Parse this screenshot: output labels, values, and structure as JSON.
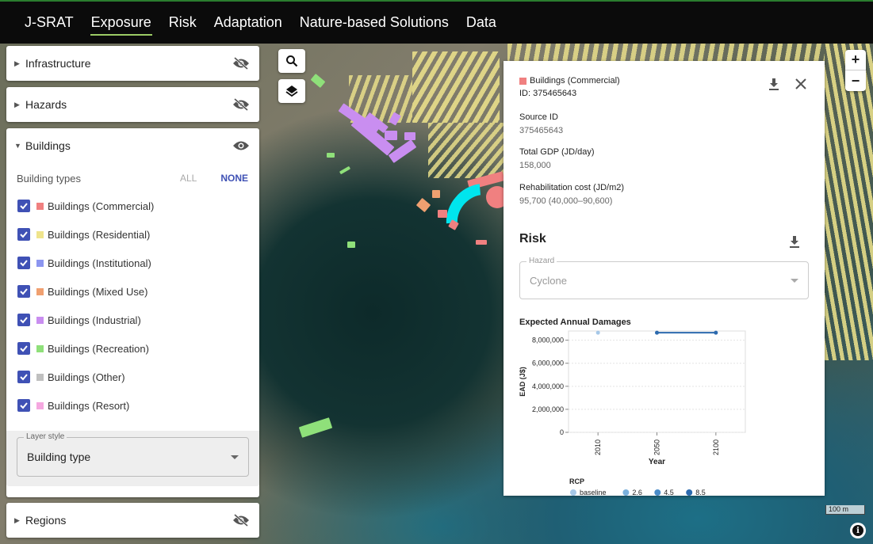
{
  "nav": {
    "brand": "J-SRAT",
    "items": [
      "Exposure",
      "Risk",
      "Adaptation",
      "Nature-based Solutions",
      "Data"
    ]
  },
  "sidebar": {
    "infrastructure": "Infrastructure",
    "hazards": "Hazards",
    "buildings": "Buildings",
    "regions": "Regions",
    "building_types_label": "Building types",
    "all_label": "ALL",
    "none_label": "NONE",
    "building_types": [
      {
        "label": "Buildings (Commercial)",
        "color": "#f08080",
        "checked": true
      },
      {
        "label": "Buildings (Residential)",
        "color": "#efe48c",
        "checked": true
      },
      {
        "label": "Buildings (Institutional)",
        "color": "#8c96f0",
        "checked": true
      },
      {
        "label": "Buildings (Mixed Use)",
        "color": "#f0a070",
        "checked": true
      },
      {
        "label": "Buildings (Industrial)",
        "color": "#c98ef0",
        "checked": true
      },
      {
        "label": "Buildings (Recreation)",
        "color": "#8fe07a",
        "checked": true
      },
      {
        "label": "Buildings (Other)",
        "color": "#c0c0c0",
        "checked": true
      },
      {
        "label": "Buildings (Resort)",
        "color": "#f5a8e0",
        "checked": true
      }
    ],
    "layer_style_label": "Layer style",
    "layer_style_value": "Building type"
  },
  "popup": {
    "feature_type": "Buildings (Commercial)",
    "feature_color": "#f08080",
    "id_line": "ID: 375465643",
    "fields": [
      {
        "label": "Source ID",
        "value": "375465643"
      },
      {
        "label": "Total GDP (JD/day)",
        "value": "158,000"
      },
      {
        "label": "Rehabilitation cost (JD/m2)",
        "value": "95,700 (40,000–90,600)"
      }
    ],
    "risk_title": "Risk",
    "hazard_label": "Hazard",
    "hazard_value": "Cyclone",
    "chart_title": "Expected Annual Damages"
  },
  "chart_data": {
    "type": "line",
    "title": "Expected Annual Damages",
    "xlabel": "Year",
    "ylabel": "EAD (J$)",
    "x": [
      "2010",
      "2050",
      "2100"
    ],
    "yticks": [
      "0",
      "2,000,000",
      "4,000,000",
      "6,000,000",
      "8,000,000"
    ],
    "ylim": [
      0,
      8800000
    ],
    "grid": true,
    "legend_title": "RCP",
    "legend_placement": "bottom",
    "series": [
      {
        "name": "baseline",
        "color": "#a6c8e8",
        "points": [
          [
            "2010",
            8650000
          ]
        ]
      },
      {
        "name": "2.6",
        "color": "#7ab0dc",
        "points": []
      },
      {
        "name": "4.5",
        "color": "#4a8cc8",
        "points": []
      },
      {
        "name": "8.5",
        "color": "#2c6aae",
        "points": [
          [
            "2050",
            8650000
          ],
          [
            "2100",
            8650000
          ]
        ]
      }
    ]
  },
  "map": {
    "scale_label": "100 m",
    "zoom_in": "+",
    "zoom_out": "−",
    "info_label": "i"
  }
}
